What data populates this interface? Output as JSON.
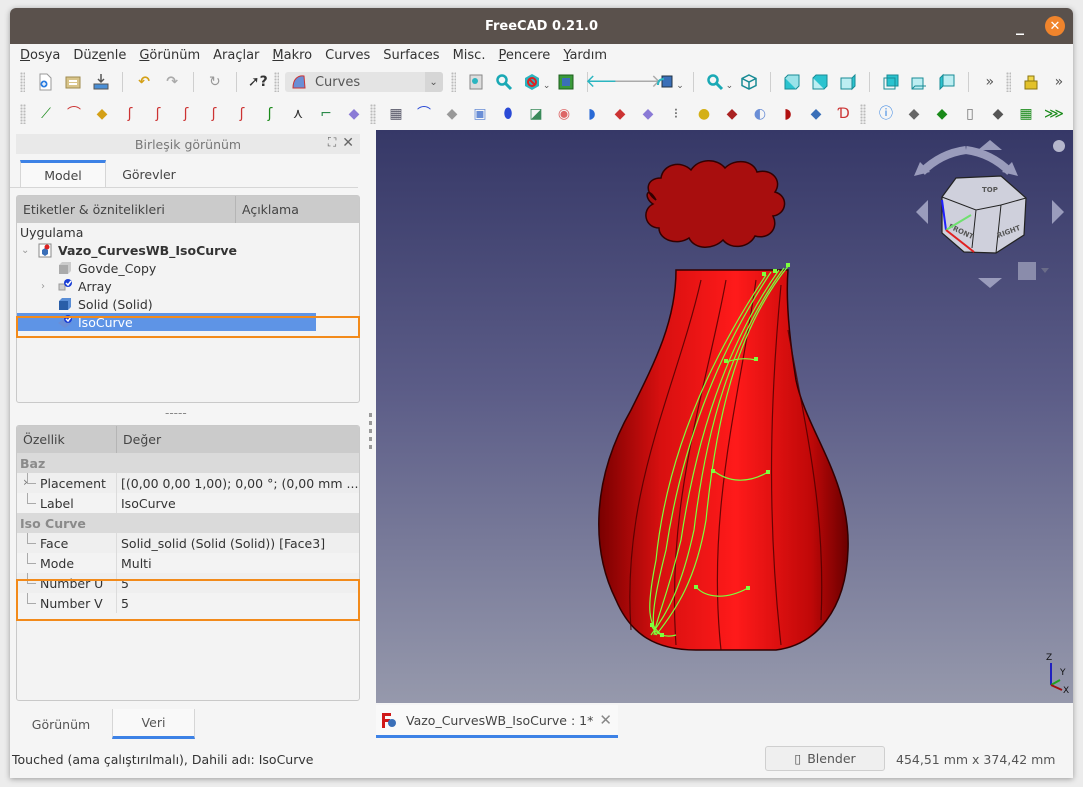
{
  "window": {
    "title": "FreeCAD 0.21.0"
  },
  "menu": [
    {
      "label": "Dosya",
      "u": "D"
    },
    {
      "label": "Düzenle",
      "u": "e"
    },
    {
      "label": "Görünüm",
      "u": "G"
    },
    {
      "label": "Araçlar",
      "u": ""
    },
    {
      "label": "Makro",
      "u": "M"
    },
    {
      "label": "Curves",
      "u": ""
    },
    {
      "label": "Surfaces",
      "u": ""
    },
    {
      "label": "Misc.",
      "u": ""
    },
    {
      "label": "Pencere",
      "u": "P"
    },
    {
      "label": "Yardım",
      "u": "Y"
    }
  ],
  "toolbar": {
    "workbench": "Curves",
    "overflow": "»"
  },
  "combo_view": {
    "title": "Birleşik görünüm",
    "tabs": [
      "Model",
      "Görevler"
    ],
    "active_tab": "Model",
    "tree": {
      "col_labels": "Etiketler & öznitelikleri",
      "col_description": "Açıklama",
      "root": "Uygulama",
      "document": "Vazo_CurvesWB_IsoCurve",
      "items": [
        {
          "label": "Govde_Copy",
          "icon": "grey-box-icon"
        },
        {
          "label": "Array",
          "icon": "array-icon",
          "expandable": true
        },
        {
          "label": "Solid (Solid)",
          "icon": "blue-solid-icon"
        },
        {
          "label": "IsoCurve",
          "icon": "isocurve-icon",
          "selected": true
        }
      ]
    },
    "splitter": "-----",
    "properties": {
      "col_property": "Özellik",
      "col_value": "Değer",
      "groups": [
        {
          "name": "Baz",
          "rows": [
            {
              "key": "Placement",
              "value": "[(0,00 0,00 1,00); 0,00 °; (0,00 mm  ...",
              "expandable": true
            },
            {
              "key": "Label",
              "value": "IsoCurve"
            }
          ]
        },
        {
          "name": "Iso Curve",
          "rows": [
            {
              "key": "Face",
              "value": "Solid_solid (Solid (Solid)) [Face3]"
            },
            {
              "key": "Mode",
              "value": "Multi"
            },
            {
              "key": "Number U",
              "value": "5"
            },
            {
              "key": "Number V",
              "value": "5"
            }
          ]
        }
      ]
    },
    "bottom_tabs": [
      "Görünüm",
      "Veri"
    ],
    "active_bottom_tab": "Veri"
  },
  "viewport": {
    "navcube_faces": [
      "TOP",
      "FRONT",
      "RIGHT"
    ],
    "axis_labels": [
      "Z",
      "Y",
      "X"
    ],
    "colors": {
      "model": "#e01010",
      "isocurve": "#7dff3c"
    }
  },
  "document_tab": {
    "label": "Vazo_CurvesWB_IsoCurve : 1*"
  },
  "status": {
    "message": "Touched (ama çalıştırılmalı), Dahili adı: IsoCurve",
    "nav_style": "Blender",
    "dimensions": "454,51 mm x 374,42 mm"
  }
}
